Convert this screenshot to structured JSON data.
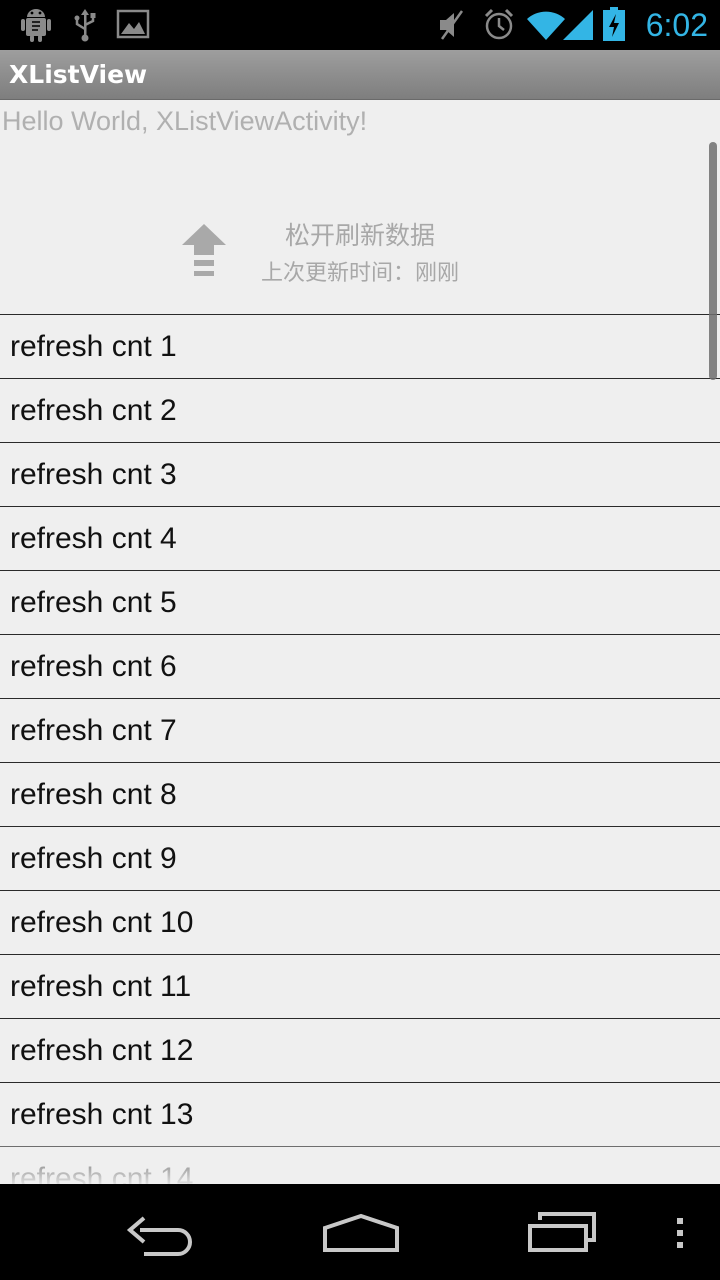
{
  "status_bar": {
    "time": "6:02",
    "left_icons": [
      "android-debug-icon",
      "usb-icon",
      "image-icon"
    ],
    "right_icons": [
      "mute-icon",
      "alarm-icon",
      "wifi-icon",
      "signal-icon",
      "battery-charging-icon"
    ],
    "accent_color": "#33b5e5"
  },
  "action_bar": {
    "title": "XListView"
  },
  "content": {
    "hello_text": "Hello World, XListViewActivity!"
  },
  "refresh_header": {
    "hint": "松开刷新数据",
    "time_label": "上次更新时间：",
    "time_value": "刚刚",
    "icon": "arrow-up-icon"
  },
  "list": {
    "items": [
      "refresh cnt 1",
      "refresh cnt 2",
      "refresh cnt 3",
      "refresh cnt 4",
      "refresh cnt 5",
      "refresh cnt 6",
      "refresh cnt 7",
      "refresh cnt 8",
      "refresh cnt 9",
      "refresh cnt 10",
      "refresh cnt 11",
      "refresh cnt 12",
      "refresh cnt 13",
      "refresh cnt 14"
    ]
  },
  "nav_bar": {
    "buttons": [
      "back-icon",
      "home-icon",
      "recent-apps-icon",
      "menu-overflow-icon"
    ]
  }
}
